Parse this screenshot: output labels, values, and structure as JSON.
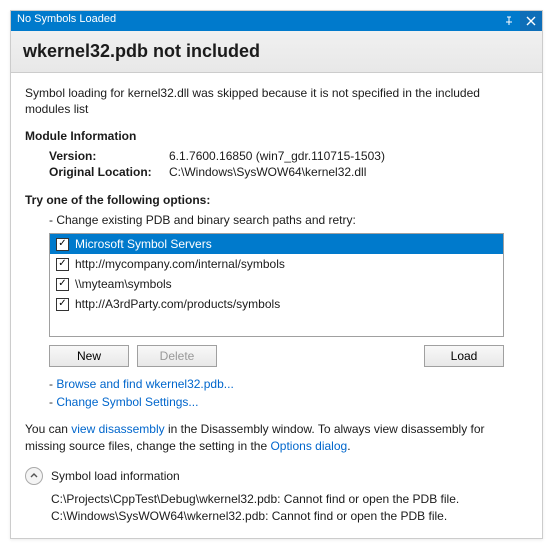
{
  "titlebar": {
    "title": "No Symbols Loaded"
  },
  "header": "wkernel32.pdb not included",
  "message": "Symbol loading for kernel32.dll was skipped because it is not specified in the included modules list",
  "moduleInfo": {
    "heading": "Module Information",
    "versionLabel": "Version:",
    "version": "6.1.7600.16850 (win7_gdr.110715-1503)",
    "locLabel": "Original Location:",
    "loc": "C:\\Windows\\SysWOW64\\kernel32.dll"
  },
  "options": {
    "heading": "Try one of the following options:",
    "changePaths": "- Change existing PDB and binary search paths and retry:",
    "items": [
      "Microsoft Symbol Servers",
      "http://mycompany.com/internal/symbols",
      "\\\\myteam\\symbols",
      "http://A3rdParty.com/products/symbols"
    ],
    "newBtn": "New",
    "deleteBtn": "Delete",
    "loadBtn": "Load",
    "browseLink": "Browse and find wkernel32.pdb...",
    "settingsLink": "Change Symbol Settings..."
  },
  "disasm": {
    "pre": "You can ",
    "link1": "view disassembly",
    "mid": " in the Disassembly window. To always view disassembly for missing source files, change the setting in the ",
    "link2": "Options dialog",
    "post": "."
  },
  "loadInfo": {
    "heading": "Symbol load information",
    "lines": [
      "C:\\Projects\\CppTest\\Debug\\wkernel32.pdb: Cannot find or open the PDB file.",
      "C:\\Windows\\SysWOW64\\wkernel32.pdb: Cannot find or open the PDB file."
    ]
  }
}
